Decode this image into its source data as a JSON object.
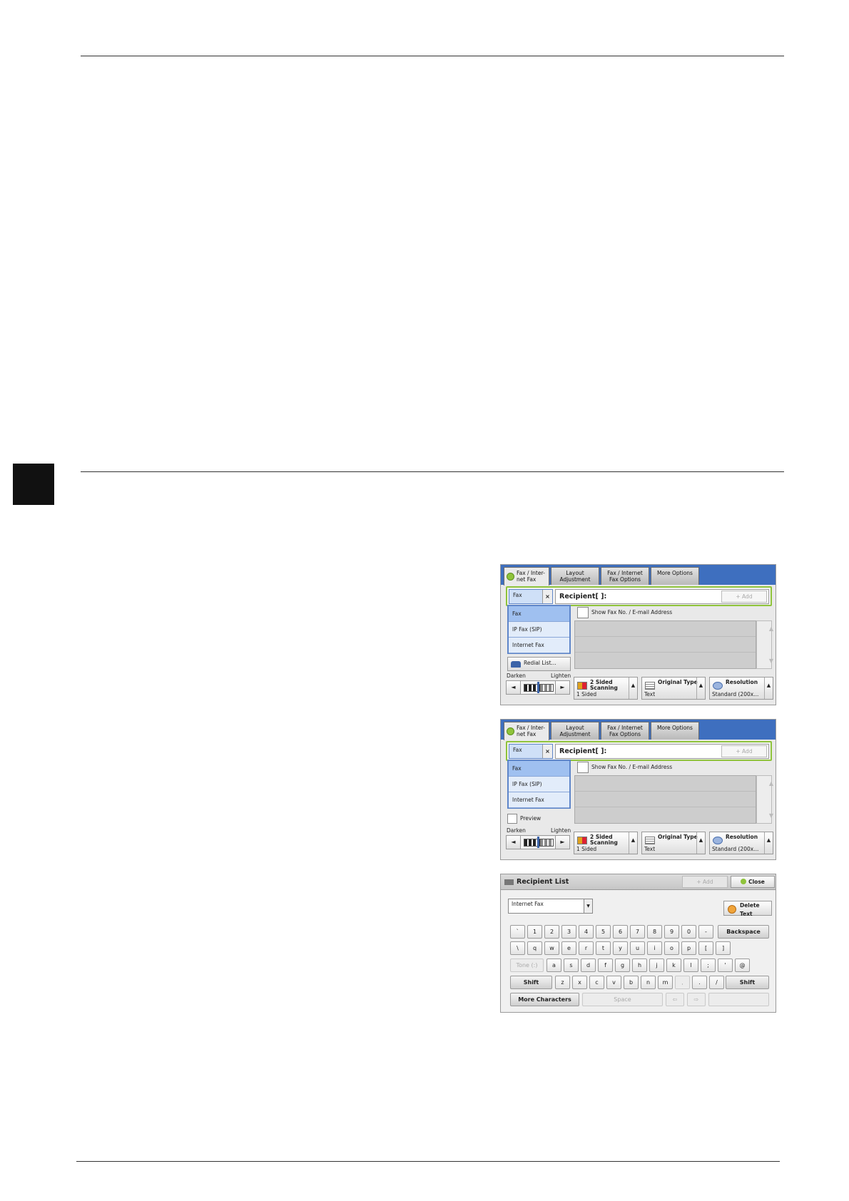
{
  "screen1": {
    "tabs": [
      "Fax / Inter-\nnet Fax",
      "Layout\nAdjustment",
      "Fax / Internet\nFax Options",
      "More Options"
    ],
    "fax_selector": "Fax",
    "recipient_label": "Recipient[    ]:",
    "add_label": "+ Add",
    "type_items": [
      "Fax",
      "IP Fax (SIP)",
      "Internet Fax"
    ],
    "redial_label": "Redial List...",
    "show_fax_label": "Show Fax No. / E-mail Address",
    "darken_label": "Darken",
    "lighten_label": "Lighten",
    "buttons": [
      {
        "name": "2 Sided\nScanning",
        "value": "1 Sided"
      },
      {
        "name": "Original Type",
        "value": "Text"
      },
      {
        "name": "Resolution",
        "value": "Standard (200x..."
      }
    ]
  },
  "screen2": {
    "tabs": [
      "Fax / Inter-\nnet Fax",
      "Layout\nAdjustment",
      "Fax / Internet\nFax Options",
      "More Options"
    ],
    "fax_selector": "Fax",
    "recipient_label": "Recipient[    ]:",
    "add_label": "+ Add",
    "type_items": [
      "Fax",
      "IP Fax (SIP)",
      "Internet Fax"
    ],
    "preview_label": "Preview",
    "show_fax_label": "Show Fax No. / E-mail Address",
    "darken_label": "Darken",
    "lighten_label": "Lighten",
    "buttons": [
      {
        "name": "2 Sided\nScanning",
        "value": "1 Sided"
      },
      {
        "name": "Original Type",
        "value": "Text"
      },
      {
        "name": "Resolution",
        "value": "Standard (200x..."
      }
    ]
  },
  "screen3": {
    "title": "Recipient List",
    "add_label": "+ Add",
    "close_label": "Close",
    "select_value": "Internet Fax",
    "delete_label": "Delete Text",
    "row1": [
      "`",
      "1",
      "2",
      "3",
      "4",
      "5",
      "6",
      "7",
      "8",
      "9",
      "0",
      "-"
    ],
    "backspace": "Backspace",
    "row2": [
      "\\",
      "q",
      "w",
      "e",
      "r",
      "t",
      "y",
      "u",
      "i",
      "o",
      "p",
      "[",
      "]"
    ],
    "tone": "Tone (:)",
    "row3": [
      "a",
      "s",
      "d",
      "f",
      "g",
      "h",
      "j",
      "k",
      "l",
      ";",
      "'",
      "@"
    ],
    "shift": "Shift",
    "row4": [
      "z",
      "x",
      "c",
      "v",
      "b",
      "n",
      "m",
      ",",
      ".",
      "/"
    ],
    "more_chars": "More Characters",
    "space": "Space"
  }
}
